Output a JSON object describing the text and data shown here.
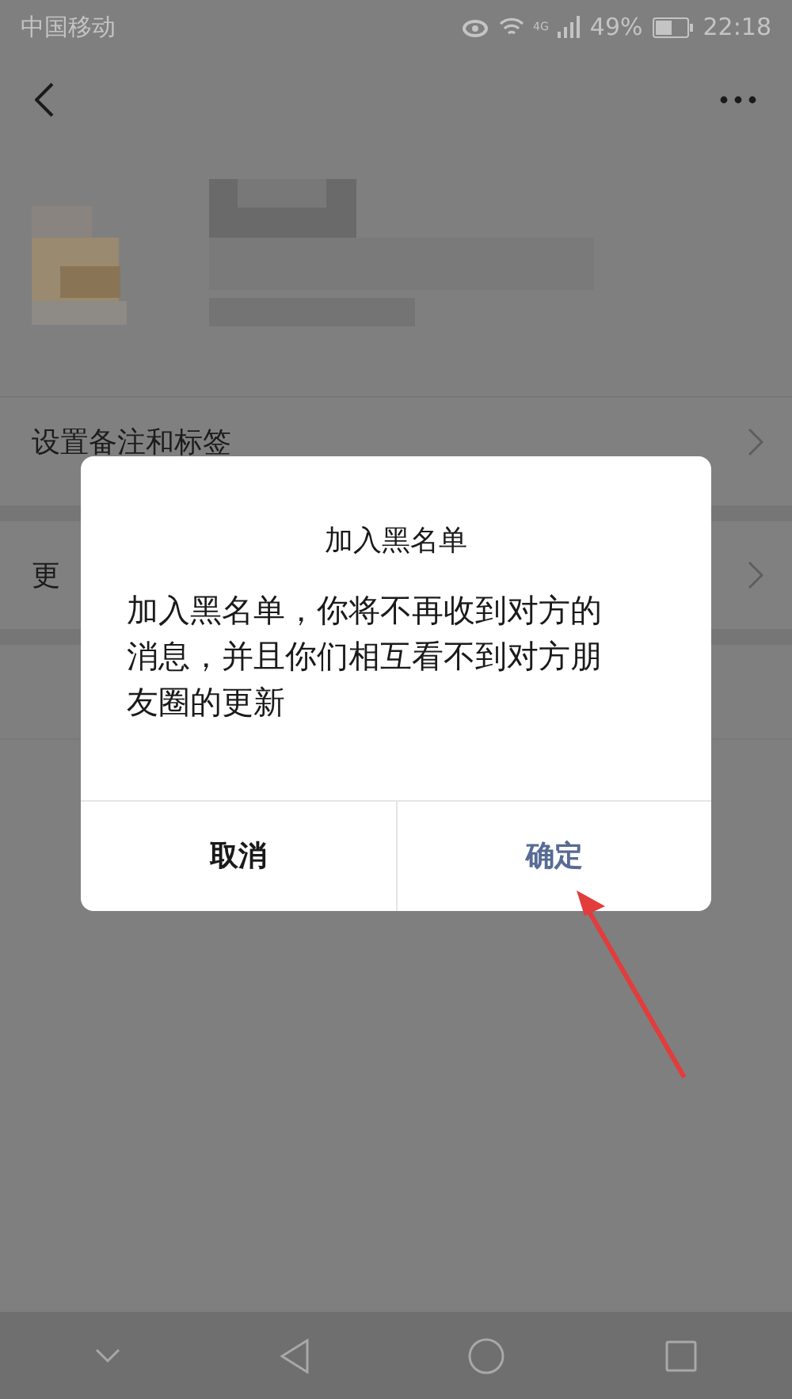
{
  "status_bar": {
    "carrier": "中国移动",
    "network": "4G",
    "battery": "49%",
    "time": "22:18"
  },
  "rows": [
    {
      "label": "设置备注和标签"
    },
    {
      "label": "更"
    }
  ],
  "dialog": {
    "title": "加入黑名单",
    "message": "加入黑名单，你将不再收到对方的消息，并且你们相互看不到对方朋友圈的更新",
    "buttons": [
      {
        "label": "取消",
        "kind": "cancel"
      },
      {
        "label": "确定",
        "kind": "confirm"
      }
    ]
  }
}
